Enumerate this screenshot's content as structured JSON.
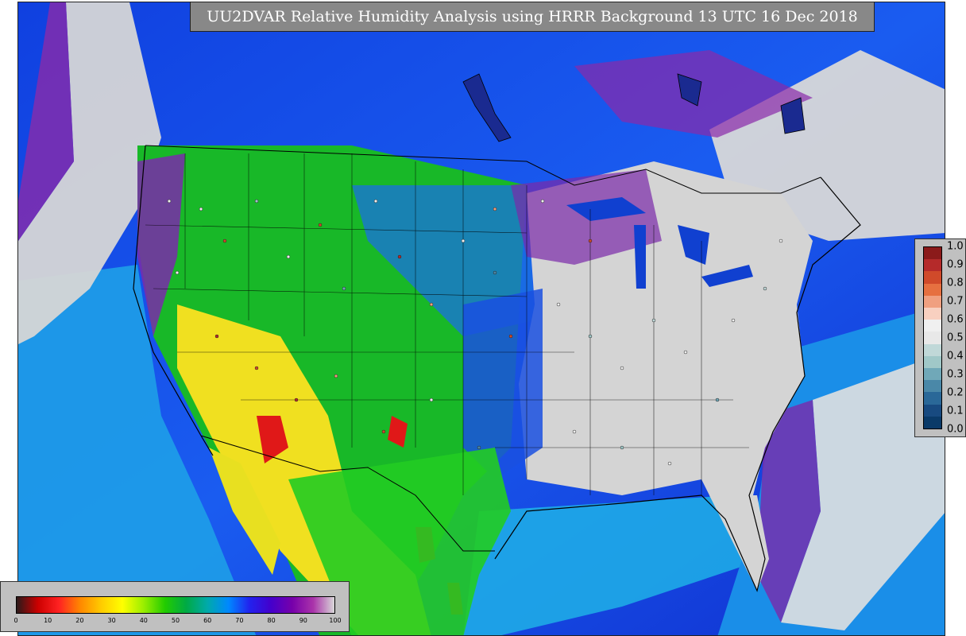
{
  "title": "UU2DVAR Relative Humidity Analysis using HRRR Background 13 UTC 16 Dec 2018",
  "rh_colorbar": {
    "ticks": [
      "0",
      "10",
      "20",
      "30",
      "40",
      "50",
      "60",
      "70",
      "80",
      "90",
      "100"
    ],
    "colors": [
      "#2a1a1a",
      "#cc0000",
      "#ff2222",
      "#ff8800",
      "#ffcc00",
      "#ffff00",
      "#99ee00",
      "#22cc00",
      "#00aa44",
      "#00aaaa",
      "#0088ff",
      "#2222ee",
      "#4400cc",
      "#7700aa",
      "#aa33aa",
      "#d8d8d8"
    ]
  },
  "obs_colorbar": {
    "ticks": [
      "1.0",
      "0.9",
      "0.8",
      "0.7",
      "0.6",
      "0.5",
      "0.4",
      "0.3",
      "0.2",
      "0.1",
      "0.0"
    ],
    "colors": [
      "#8b1a1a",
      "#b52a2a",
      "#d04a2a",
      "#e67040",
      "#f0a080",
      "#f8d0c0",
      "#f0f0f0",
      "#e8e8e8",
      "#c0d8d8",
      "#a0c8c8",
      "#70a8b8",
      "#4a88a8",
      "#2a6898",
      "#184a80",
      "#0a3a68"
    ]
  }
}
